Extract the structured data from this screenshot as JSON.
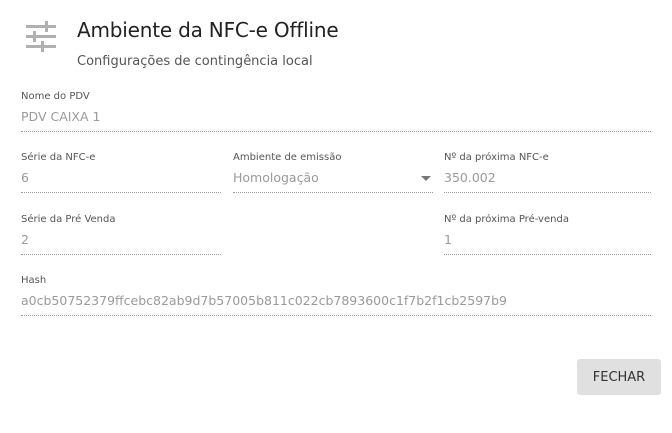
{
  "header": {
    "icon": "sliders-icon",
    "title": "Ambiente da NFC-e Offline",
    "subtitle": "Configurações de contingência local"
  },
  "fields": {
    "pdv_name": {
      "label": "Nome do PDV",
      "value": "PDV CAIXA 1"
    },
    "nfce_series": {
      "label": "Série da NFC-e",
      "value": "6"
    },
    "emission_env": {
      "label": "Ambiente de emissão",
      "value": "Homologação"
    },
    "next_nfce": {
      "label": "Nº da próxima NFC-e",
      "value": "350.002"
    },
    "presale_series": {
      "label": "Série da Pré Venda",
      "value": "2"
    },
    "next_presale": {
      "label": "Nº da próxima Pré-venda",
      "value": "1"
    },
    "hash": {
      "label": "Hash",
      "value": "a0cb50752379ffcebc82ab9d7b57005b811c022cb7893600c1f7b2f1cb2597b9"
    }
  },
  "actions": {
    "close_label": "FECHAR"
  },
  "colors": {
    "icon": "#b0b0b0",
    "button_bg": "#e0e0e0",
    "value_text": "#9a9a9a"
  }
}
